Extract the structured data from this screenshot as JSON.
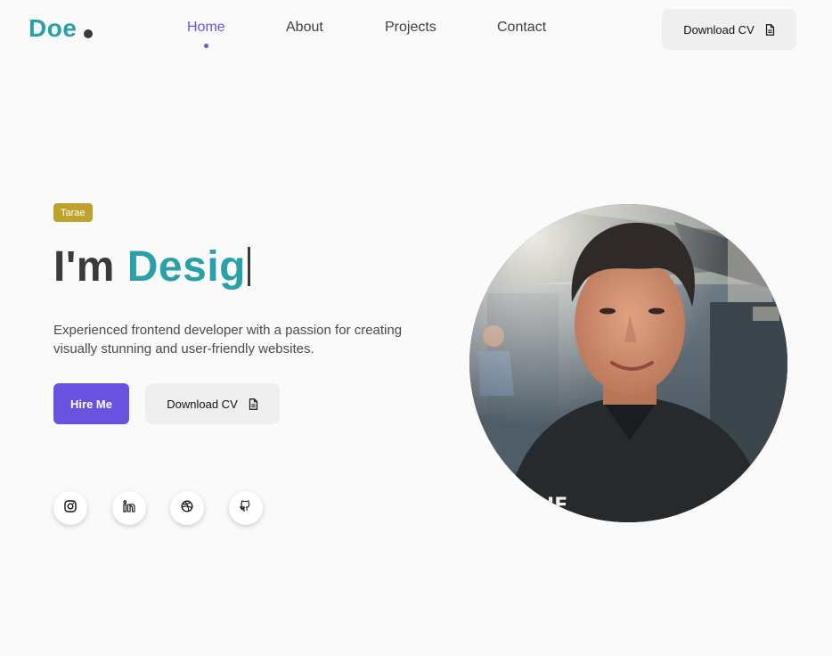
{
  "brand": {
    "logo_text": "Doe"
  },
  "nav": {
    "items": [
      {
        "label": "Home",
        "active": true
      },
      {
        "label": "About",
        "active": false
      },
      {
        "label": "Projects",
        "active": false
      },
      {
        "label": "Contact",
        "active": false
      }
    ],
    "cv_label": "Download CV"
  },
  "hero": {
    "badge": "Tarae",
    "headline_prefix": "I'm ",
    "headline_typed": "Desig",
    "description": "Experienced frontend developer with a passion for creating visually stunning and user-friendly websites.",
    "hire_label": "Hire Me",
    "cv_label": "Download CV"
  },
  "socials": [
    {
      "icon": "instagram-icon"
    },
    {
      "icon": "linkedin-icon"
    },
    {
      "icon": "dribbble-icon"
    },
    {
      "icon": "github-icon"
    }
  ],
  "colors": {
    "accent_teal": "#2aa0a8",
    "accent_purple": "#6a52e0",
    "badge_gold": "#bfa22e",
    "background": "#fafafa"
  }
}
